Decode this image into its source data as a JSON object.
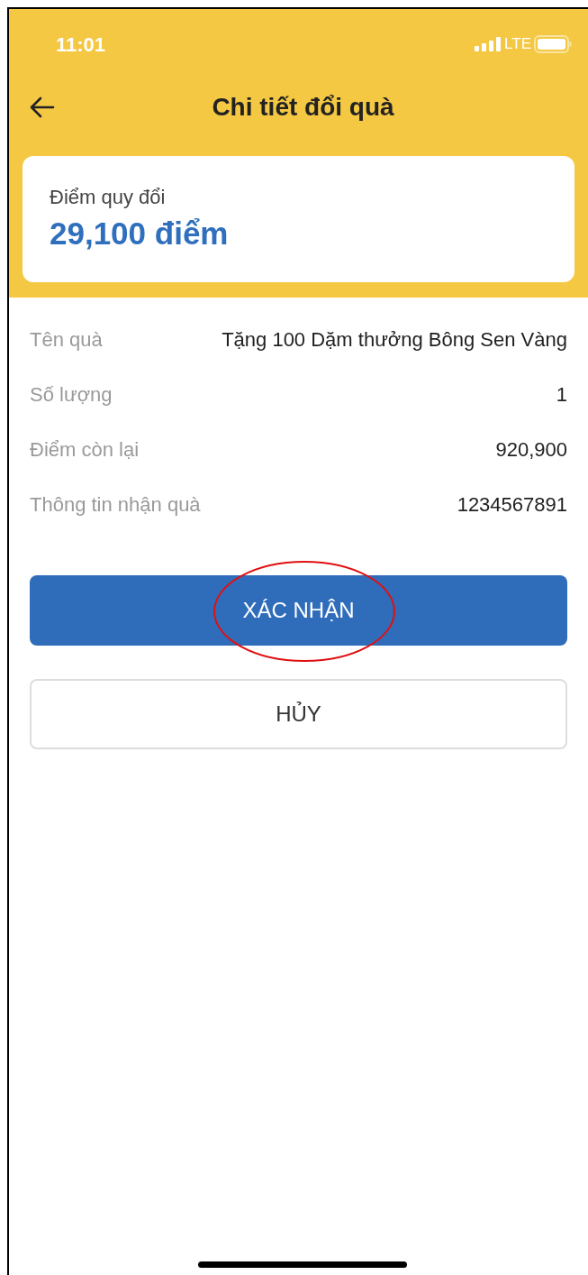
{
  "status_bar": {
    "time": "11:01",
    "network": "LTE"
  },
  "header": {
    "title": "Chi tiết đổi quà"
  },
  "points_card": {
    "label": "Điểm quy đổi",
    "value": "29,100 điểm"
  },
  "details": [
    {
      "label": "Tên quà",
      "value": "Tặng 100 Dặm thưởng Bông Sen Vàng"
    },
    {
      "label": "Số lượng",
      "value": "1"
    },
    {
      "label": "Điểm còn lại",
      "value": "920,900"
    },
    {
      "label": "Thông tin nhận quà",
      "value": "1234567891"
    }
  ],
  "buttons": [
    {
      "kind": "primary",
      "label": "XÁC NHẬN",
      "highlighted": true
    },
    {
      "kind": "secondary",
      "label": "HỦY",
      "highlighted": false
    }
  ]
}
